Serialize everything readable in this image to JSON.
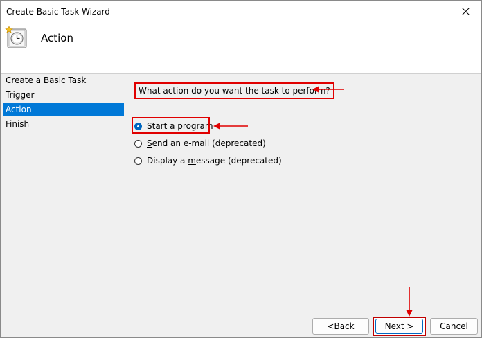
{
  "window": {
    "title": "Create Basic Task Wizard"
  },
  "header": {
    "title": "Action",
    "icon": "clock-task-icon"
  },
  "nav": {
    "items": [
      {
        "label": "Create a Basic Task",
        "active": false
      },
      {
        "label": "Trigger",
        "active": false
      },
      {
        "label": "Action",
        "active": true
      },
      {
        "label": "Finish",
        "active": false
      }
    ]
  },
  "main": {
    "question": "What action do you want the task to perform?",
    "options": [
      {
        "pre": "",
        "accel": "S",
        "post": "tart a program",
        "checked": true
      },
      {
        "pre": "",
        "accel": "S",
        "post": "end an e-mail (deprecated)",
        "checked": false
      },
      {
        "pre": "Display a ",
        "accel": "m",
        "post": "essage (deprecated)",
        "checked": false
      }
    ]
  },
  "buttons": {
    "back": {
      "pre": "< ",
      "accel": "B",
      "post": "ack"
    },
    "next": {
      "pre": "",
      "accel": "N",
      "post": "ext >"
    },
    "cancel": "Cancel"
  },
  "colors": {
    "accent": "#0078d7",
    "annotation": "#e00000"
  }
}
